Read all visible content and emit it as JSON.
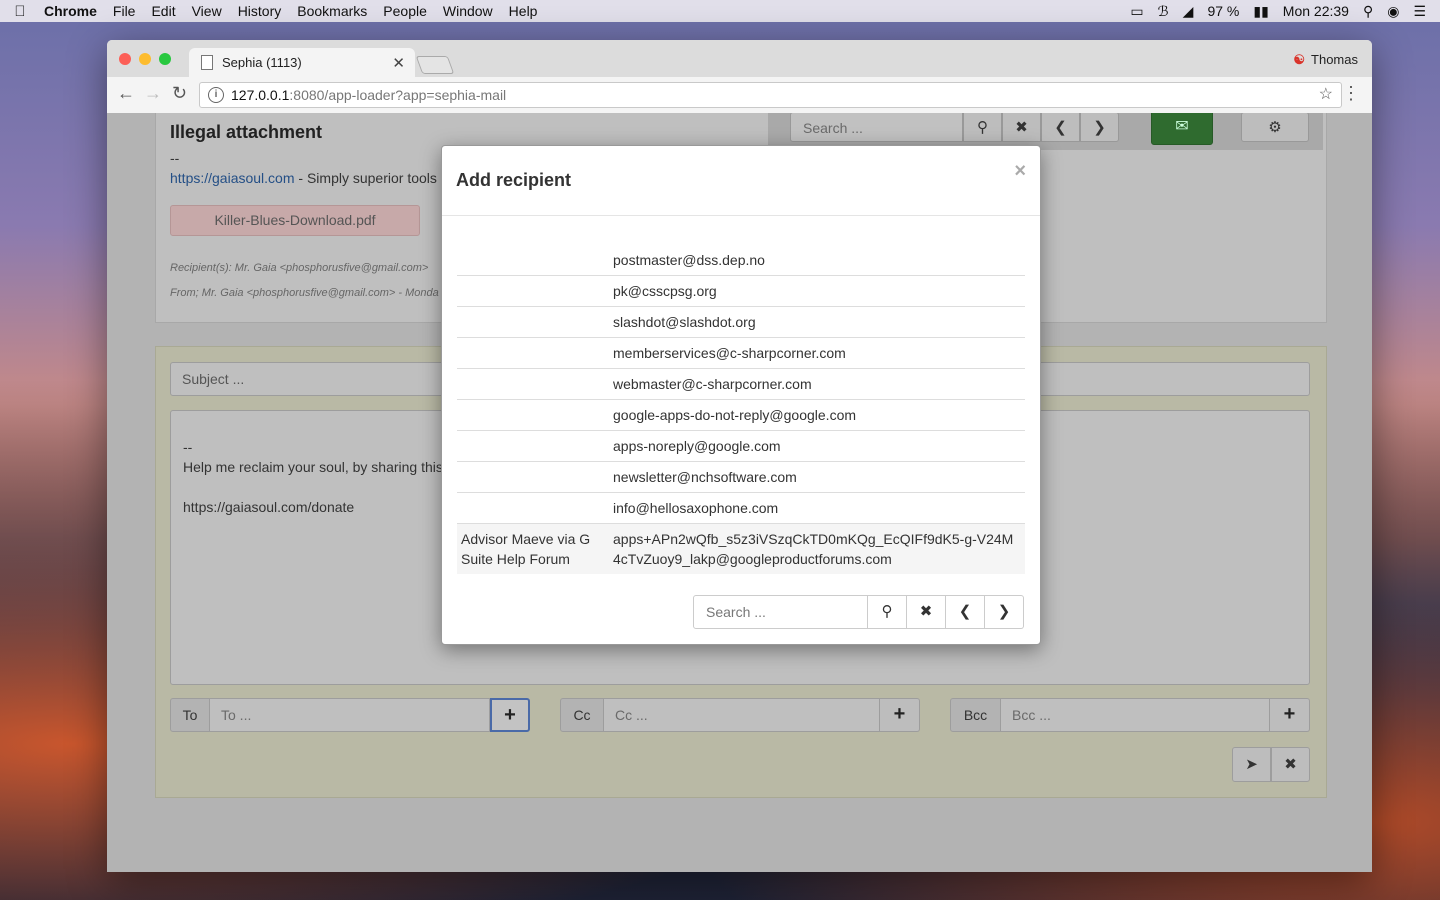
{
  "menubar": {
    "app": "Chrome",
    "items": [
      "File",
      "Edit",
      "View",
      "History",
      "Bookmarks",
      "People",
      "Window",
      "Help"
    ],
    "battery": "97 %",
    "clock": "Mon 22:39"
  },
  "browser": {
    "tab_title": "Sephia (1113)",
    "profile": "Thomas",
    "url_host": "127.0.0.1",
    "url_rest": ":8080/app-loader?app=sephia-mail"
  },
  "message": {
    "title": "Illegal attachment",
    "dash": "--",
    "sig_link": "https://gaiasoul.com",
    "sig_text": " - Simply superior tools",
    "attachment": "Killer-Blues-Download.pdf",
    "recipients": "Recipient(s): Mr. Gaia <phosphorusfive@gmail.com>",
    "from": "From; Mr. Gaia <phosphorusfive@gmail.com> - Monda",
    "search_placeholder": "Search ..."
  },
  "compose": {
    "subject_placeholder": "Subject ...",
    "body_dash": "--",
    "body_line1": "Help me reclaim your soul, by sharing this",
    "body_line2": "https://gaiasoul.com/donate",
    "to_label": "To",
    "to_placeholder": "To ...",
    "cc_label": "Cc",
    "cc_placeholder": "Cc ...",
    "bcc_label": "Bcc",
    "bcc_placeholder": "Bcc ..."
  },
  "modal": {
    "title": "Add recipient",
    "close": "×",
    "search_placeholder": "Search ...",
    "recipients": [
      {
        "name": "",
        "email": "postmaster@dss.dep.no"
      },
      {
        "name": "",
        "email": "pk@csscpsg.org"
      },
      {
        "name": "",
        "email": "slashdot@slashdot.org"
      },
      {
        "name": "",
        "email": "memberservices@c-sharpcorner.com"
      },
      {
        "name": "",
        "email": "webmaster@c-sharpcorner.com"
      },
      {
        "name": "",
        "email": "google-apps-do-not-reply@google.com"
      },
      {
        "name": "",
        "email": "apps-noreply@google.com"
      },
      {
        "name": "",
        "email": "newsletter@nchsoftware.com"
      },
      {
        "name": "",
        "email": "info@hellosaxophone.com"
      },
      {
        "name": "Advisor Maeve via G Suite Help Forum",
        "email": "apps+APn2wQfb_s5z3iVSzqCkTD0mKQg_EcQIFf9dK5-g-V24M4cTvZuoy9_lakp@googleproductforums.com"
      }
    ]
  }
}
